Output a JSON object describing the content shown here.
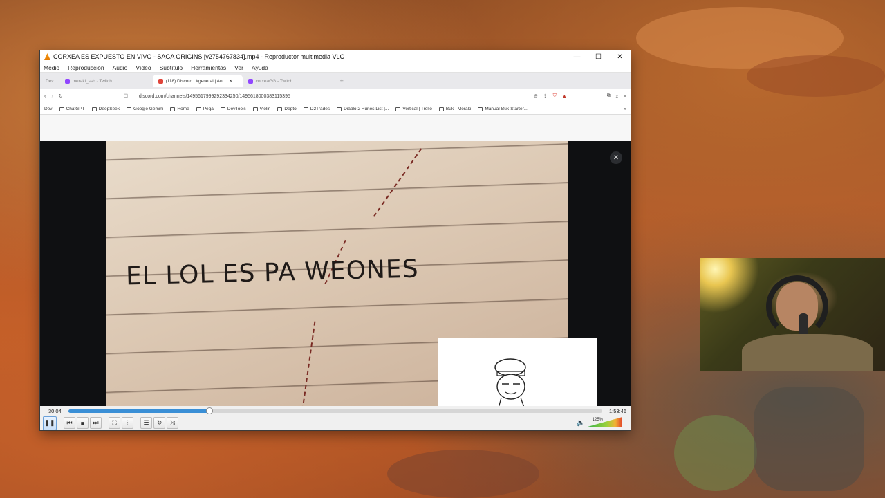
{
  "vlc": {
    "title": "CORXEA ES EXPUESTO EN VIVO - SAGA ORIGINS [v2754767834].mp4 - Reproductor multimedia VLC",
    "menu": [
      "Medio",
      "Reproducción",
      "Audio",
      "Vídeo",
      "Subtítulo",
      "Herramientas",
      "Ver",
      "Ayuda"
    ],
    "elapsed": "30:04",
    "total": "1:53:46",
    "progress": 0.265,
    "volume_label": "125%"
  },
  "browser": {
    "tabs": [
      {
        "label": "Dev",
        "active": false
      },
      {
        "label": "meraki_ssb - Twitch",
        "active": false
      },
      {
        "label": "(118) Discord | #general | An...",
        "active": true
      },
      {
        "label": "corxeaGG - Twitch",
        "active": false
      }
    ],
    "url": "discord.com/channels/1495617999292334250/1495618000383115395",
    "bookmarks": [
      "Dev",
      "ChatGPT",
      "DeepSeek",
      "Google Gemini",
      "Home",
      "Pega",
      "DevTools",
      "Violin",
      "Depto",
      "D2Trades",
      "Diablo 2 Runes List |...",
      "Vertical | Trello",
      "Buk - Meraki",
      "Manual-Buk-Starter..."
    ]
  },
  "meme": {
    "text": "EL LOL ES PA WEONES"
  }
}
